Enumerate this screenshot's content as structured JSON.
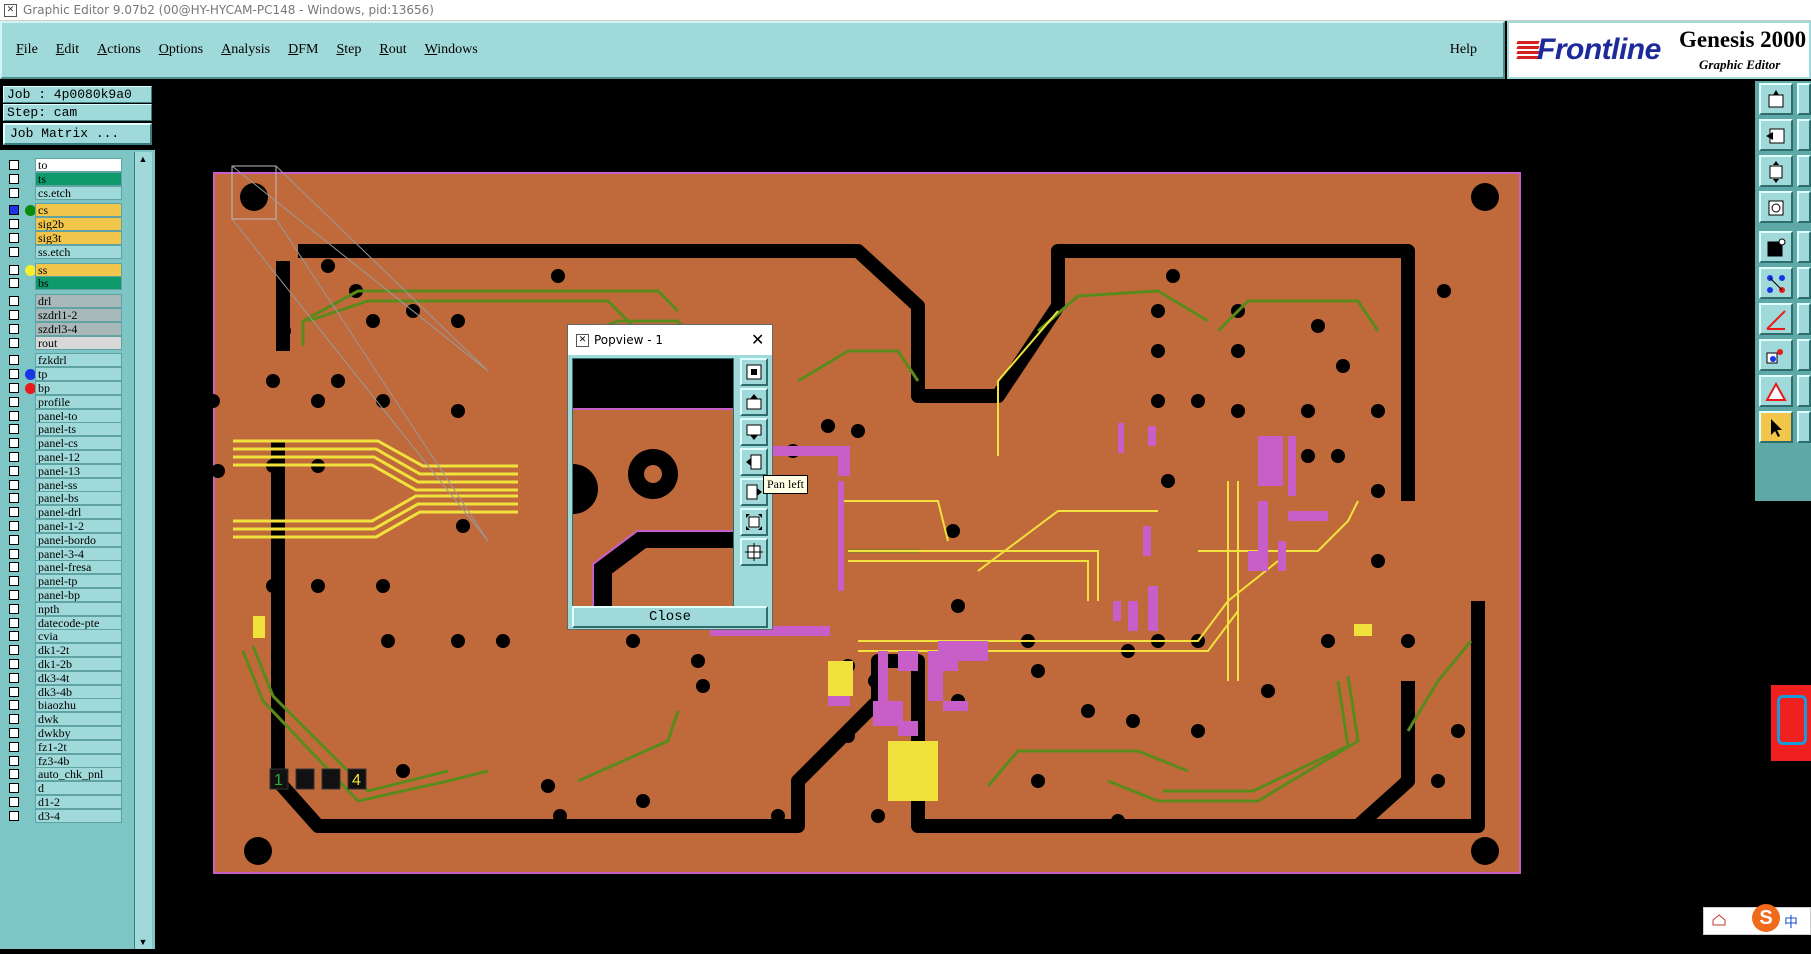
{
  "window": {
    "title": "Graphic Editor 9.07b2 (00@HY-HYCAM-PC148 - Windows, pid:13656)"
  },
  "menu": {
    "items": [
      "File",
      "Edit",
      "Actions",
      "Options",
      "Analysis",
      "DFM",
      "Step",
      "Rout",
      "Windows"
    ],
    "help": "Help"
  },
  "brand": {
    "logo": "Frontline",
    "product": "Genesis 2000",
    "subtitle": "Graphic Editor"
  },
  "job": {
    "job_label": "Job : 4p0080k9a0",
    "step_label": "Step: cam",
    "matrix_button": "Job Matrix ..."
  },
  "colors": {
    "board": "#c06a3c",
    "layer_white": "#ffffff",
    "layer_green": "#0f9a6c",
    "layer_yellow": "#f2c64a",
    "layer_gray": "#a9b8b8",
    "layer_teal": "#9fd9d9",
    "trace_green": "#5b8a1c",
    "trace_yellow": "#f1e13c",
    "pad_magenta": "#c85fc8"
  },
  "layers": [
    {
      "name": "to",
      "bg": "#ffffff",
      "dot": ""
    },
    {
      "name": "ts",
      "bg": "#0f9a6c",
      "dot": ""
    },
    {
      "name": "cs.etch",
      "bg": "#9fd9d9",
      "dot": ""
    },
    {
      "name": "cs",
      "bg": "#f2c64a",
      "dot": "#0a8a0a",
      "active": true
    },
    {
      "name": "sig2b",
      "bg": "#f2c64a",
      "dot": ""
    },
    {
      "name": "sig3t",
      "bg": "#f2c64a",
      "dot": ""
    },
    {
      "name": "ss.etch",
      "bg": "#9fd9d9",
      "dot": ""
    },
    {
      "name": "ss",
      "bg": "#f2c64a",
      "dot": "#f7ef2a"
    },
    {
      "name": "bs",
      "bg": "#0f9a6c",
      "dot": ""
    },
    {
      "name": "drl",
      "bg": "#a9b8b8",
      "dot": ""
    },
    {
      "name": "szdrl1-2",
      "bg": "#a9b8b8",
      "dot": ""
    },
    {
      "name": "szdrl3-4",
      "bg": "#a9b8b8",
      "dot": ""
    },
    {
      "name": "rout",
      "bg": "#d8d8d8",
      "dot": ""
    },
    {
      "name": "fzkdrl",
      "bg": "#9fd9d9",
      "dot": ""
    },
    {
      "name": "tp",
      "bg": "#9fd9d9",
      "dot": "#1a35e8"
    },
    {
      "name": "bp",
      "bg": "#9fd9d9",
      "dot": "#e81a1a"
    },
    {
      "name": "profile",
      "bg": "#9fd9d9",
      "dot": ""
    },
    {
      "name": "panel-to",
      "bg": "#9fd9d9",
      "dot": ""
    },
    {
      "name": "panel-ts",
      "bg": "#9fd9d9",
      "dot": ""
    },
    {
      "name": "panel-cs",
      "bg": "#9fd9d9",
      "dot": ""
    },
    {
      "name": "panel-12",
      "bg": "#9fd9d9",
      "dot": ""
    },
    {
      "name": "panel-13",
      "bg": "#9fd9d9",
      "dot": ""
    },
    {
      "name": "panel-ss",
      "bg": "#9fd9d9",
      "dot": ""
    },
    {
      "name": "panel-bs",
      "bg": "#9fd9d9",
      "dot": ""
    },
    {
      "name": "panel-drl",
      "bg": "#9fd9d9",
      "dot": ""
    },
    {
      "name": "panel-1-2",
      "bg": "#9fd9d9",
      "dot": ""
    },
    {
      "name": "panel-bordo",
      "bg": "#9fd9d9",
      "dot": ""
    },
    {
      "name": "panel-3-4",
      "bg": "#9fd9d9",
      "dot": ""
    },
    {
      "name": "panel-fresa",
      "bg": "#9fd9d9",
      "dot": ""
    },
    {
      "name": "panel-tp",
      "bg": "#9fd9d9",
      "dot": ""
    },
    {
      "name": "panel-bp",
      "bg": "#9fd9d9",
      "dot": ""
    },
    {
      "name": "npth",
      "bg": "#9fd9d9",
      "dot": ""
    },
    {
      "name": "datecode-pte",
      "bg": "#9fd9d9",
      "dot": ""
    },
    {
      "name": "cvia",
      "bg": "#9fd9d9",
      "dot": ""
    },
    {
      "name": "dk1-2t",
      "bg": "#9fd9d9",
      "dot": ""
    },
    {
      "name": "dk1-2b",
      "bg": "#9fd9d9",
      "dot": ""
    },
    {
      "name": "dk3-4t",
      "bg": "#9fd9d9",
      "dot": ""
    },
    {
      "name": "dk3-4b",
      "bg": "#9fd9d9",
      "dot": ""
    },
    {
      "name": "biaozhu",
      "bg": "#9fd9d9",
      "dot": ""
    },
    {
      "name": "dwk",
      "bg": "#9fd9d9",
      "dot": ""
    },
    {
      "name": "dwkby",
      "bg": "#9fd9d9",
      "dot": ""
    },
    {
      "name": "fz1-2t",
      "bg": "#9fd9d9",
      "dot": ""
    },
    {
      "name": "fz3-4b",
      "bg": "#9fd9d9",
      "dot": ""
    },
    {
      "name": "auto_chk_pnl",
      "bg": "#9fd9d9",
      "dot": ""
    },
    {
      "name": "d",
      "bg": "#9fd9d9",
      "dot": ""
    },
    {
      "name": "d1-2",
      "bg": "#9fd9d9",
      "dot": ""
    },
    {
      "name": "d3-4",
      "bg": "#9fd9d9",
      "dot": ""
    }
  ],
  "board": {
    "marker_1": "1",
    "marker_4": "4"
  },
  "popview": {
    "title": "Popview - 1",
    "close_label": "Close",
    "tooltip": "Pan left"
  },
  "ime": {
    "logo": "S",
    "lang": "中"
  }
}
